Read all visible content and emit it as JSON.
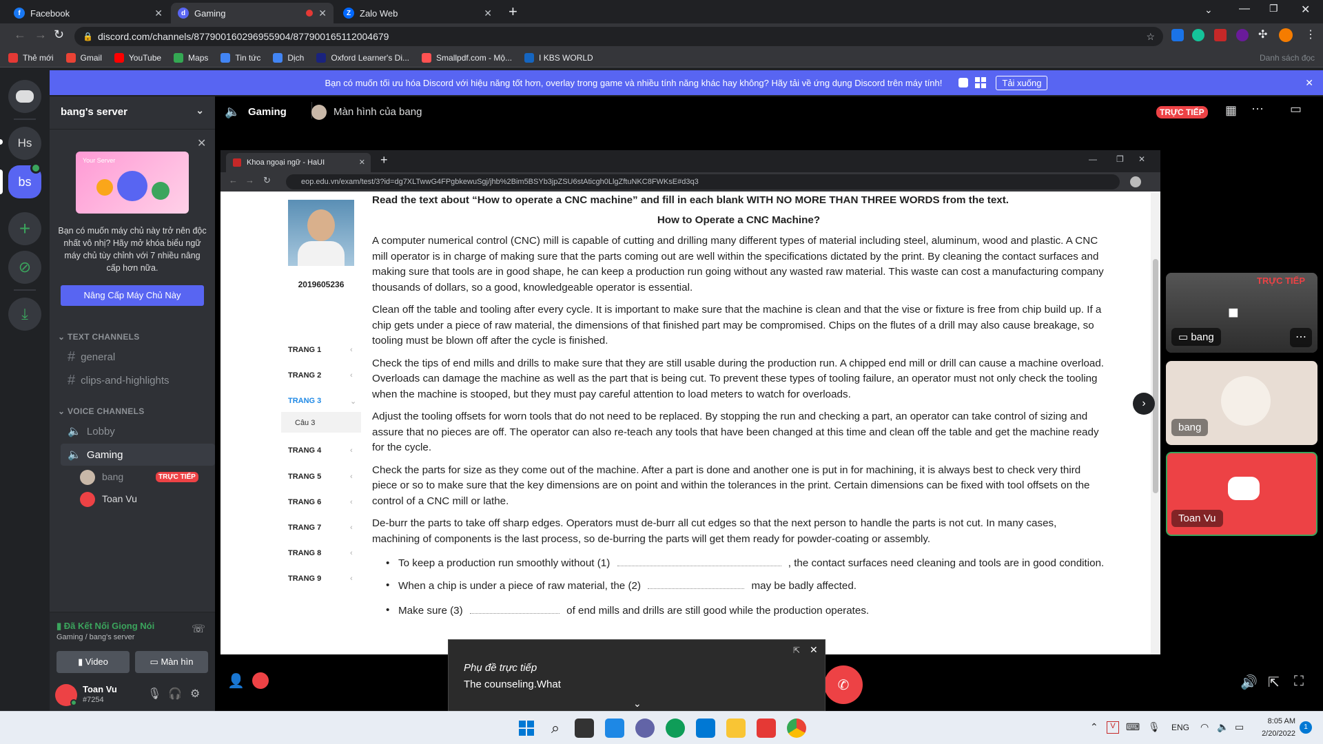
{
  "browser": {
    "tabs": [
      {
        "label": "Facebook",
        "color": "#1877f2",
        "glyph": "f"
      },
      {
        "label": "Gaming",
        "color": "#5865f2",
        "glyph": "d"
      },
      {
        "label": "Zalo Web",
        "color": "#0068ff",
        "glyph": "Z"
      }
    ],
    "new_tab": "+",
    "url": "discord.com/channels/877900160296955904/877900165112004679",
    "bookmarks": [
      "Thẻ mới",
      "Gmail",
      "YouTube",
      "Maps",
      "Tin tức",
      "Dịch",
      "Oxford Learner's Di...",
      "Smallpdf.com - Mộ...",
      "I KBS WORLD"
    ],
    "bookmark_colors": [
      "#e53935",
      "#ea4335",
      "#ff0000",
      "#34a853",
      "#4285f4",
      "#4285f4",
      "#1a237e",
      "#ff5252",
      "#1565c0"
    ],
    "other_bookmarks": "Danh sách đọc"
  },
  "banner": {
    "text": "Bạn có muốn tối ưu hóa Discord với hiệu năng tốt hơn, overlay trong game và nhiều tính năng khác hay không? Hãy tải về ứng dụng Discord trên máy tính!",
    "download": "Tải xuống"
  },
  "guilds": {
    "hs": "Hs",
    "bs": "bs"
  },
  "server": {
    "name": "bang's server",
    "promo_text": "Bạn có muốn máy chủ này trở nên độc nhất vô nhị? Hãy mở khóa biểu ngữ máy chủ tùy chỉnh với 7 nhiều nâng cấp hơn nữa.",
    "promo_card_label": "Your Server",
    "upgrade_button": "Nâng Cấp Máy Chủ Này",
    "text_channels_header": "TEXT CHANNELS",
    "text_channels": [
      "general",
      "clips-and-highlights"
    ],
    "voice_channels_header": "VOICE CHANNELS",
    "voice_channels": [
      "Lobby",
      "Gaming"
    ],
    "voice_members": [
      {
        "name": "bang",
        "badge": "TRỰC TIẾP"
      },
      {
        "name": "Toan Vu"
      }
    ],
    "voice_status": "Đã Kết Nối Giọng Nói",
    "voice_location": "Gaming / bang's server",
    "video_btn": "Video",
    "screen_btn": "Màn hìn",
    "user_name": "Toan Vu",
    "user_tag": "#7254"
  },
  "header": {
    "channel": "Gaming",
    "stream_label": "Màn hình của bang",
    "live_badge": "TRỰC TIẾP"
  },
  "shared": {
    "tab_title": "Khoa ngoại ngữ - HaUI",
    "url": "eop.edu.vn/exam/test/3?id=dg7XLTwwG4FPgbkewuSgj/jhb%2Bim5BSYb3jpZSU6stAticgh0LlgZftuNKC8FWKsE#d3q3",
    "student_id": "2019605236",
    "pages": [
      "TRANG 1",
      "TRANG 2",
      "TRANG 3",
      "TRANG 4",
      "TRANG 5",
      "TRANG 6",
      "TRANG 7",
      "TRANG 8",
      "TRANG 9"
    ],
    "sub_item": "Câu 3",
    "instruction": "Read the text about “How to operate a CNC machine” and fill in each blank WITH NO MORE THAN THREE WORDS from the text.",
    "title": "How to Operate a CNC Machine?",
    "paragraphs": [
      "A computer numerical control (CNC) mill is capable of cutting and drilling many different types of material including steel, aluminum, wood and plastic. A CNC mill operator is in charge of making sure that the parts coming out are well within the specifications dictated by the print. By cleaning the contact surfaces and making sure that tools are in good shape, he can keep a production run going without any wasted raw material. This waste can cost a manufacturing company thousands of dollars, so a good, knowledgeable operator is essential.",
      "Clean off the table and tooling after every cycle. It is important to make sure that the machine is clean and that the vise or fixture is free from chip build up. If a chip gets under a piece of raw material, the dimensions of that finished part may be compromised. Chips on the flutes of a drill may also cause breakage, so tooling must be blown off after the cycle is finished.",
      "Check the tips of end mills and drills to make sure that they are still usable during the production run. A chipped end mill or drill can cause a machine overload. Overloads can damage the machine as well as the part that is being cut. To prevent these types of tooling failure, an operator must not only check the tooling when the machine is stooped, but they must pay careful attention to load meters to watch for overloads.",
      "Adjust the tooling offsets for worn tools that do not need to be replaced. By stopping the run and checking a part, an operator can take control of sizing and assure that no pieces are off. The operator can also re-teach any tools that have been changed at this time and clean off the table and get the machine ready for the cycle.",
      "Check the parts for size as they come out of the machine. After a part is done and another one is put in for machining, it is always best to check very third piece or so to make sure that the key dimensions are on point and within the tolerances in the print. Certain dimensions can be fixed with tool offsets on the control of a CNC mill or lathe.",
      "De-burr the parts to take off sharp edges. Operators must de-burr all cut edges so that the next person to handle the parts is not cut. In many cases, machining of components is the last process, so de-burring the parts will get them ready for powder-coating or assembly."
    ],
    "q1_before": "To keep a production run smoothly without (1)",
    "q1_after": ", the contact surfaces need cleaning and tools are in good condition.",
    "q2_before": "When a chip is under a piece of raw material, the (2)",
    "q2_after": "may be badly affected.",
    "q3_before": "Make sure (3)",
    "q3_after": "of end mills and drills are still good while the production operates."
  },
  "participants": [
    {
      "name": "bang",
      "live": "TRỰC TIẾP"
    },
    {
      "name": "bang"
    },
    {
      "name": "Toan Vu"
    }
  ],
  "caption": {
    "title": "Phụ đề trực tiếp",
    "text": "The counseling.What"
  },
  "taskbar": {
    "lang": "ENG",
    "time": "8:05 AM",
    "date": "2/20/2022",
    "notif": "1"
  }
}
